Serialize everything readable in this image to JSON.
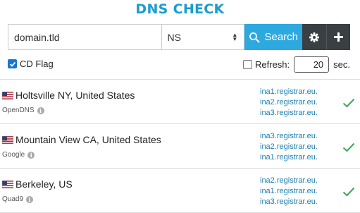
{
  "title": "DNS CHECK",
  "search": {
    "domain_value": "domain.tld",
    "record_type": "NS",
    "button_label": "Search"
  },
  "options": {
    "cd_flag_label": "CD Flag",
    "cd_flag_checked": true,
    "refresh_label": "Refresh:",
    "refresh_value": "20",
    "refresh_unit": "sec.",
    "refresh_checked": false
  },
  "results": [
    {
      "flag": "us-flag-icon",
      "location": "Holtsville NY, United States",
      "provider": "OpenDNS",
      "answers": [
        "ina1.registrar.eu.",
        "ina2.registrar.eu.",
        "ina3.registrar.eu."
      ],
      "status": "ok"
    },
    {
      "flag": "us-flag-icon",
      "location": "Mountain View CA, United States",
      "provider": "Google",
      "answers": [
        "ina3.registrar.eu.",
        "ina2.registrar.eu.",
        "ina1.registrar.eu."
      ],
      "status": "ok"
    },
    {
      "flag": "us-flag-icon",
      "location": "Berkeley, US",
      "provider": "Quad9",
      "answers": [
        "ina2.registrar.eu.",
        "ina1.registrar.eu.",
        "ina3.registrar.eu."
      ],
      "status": "ok"
    }
  ],
  "colors": {
    "accent": "#2ea9df",
    "title": "#1a9dd2",
    "dark_button": "#3a3f44",
    "check": "#3aa757",
    "answer_link": "#1b7fae"
  }
}
